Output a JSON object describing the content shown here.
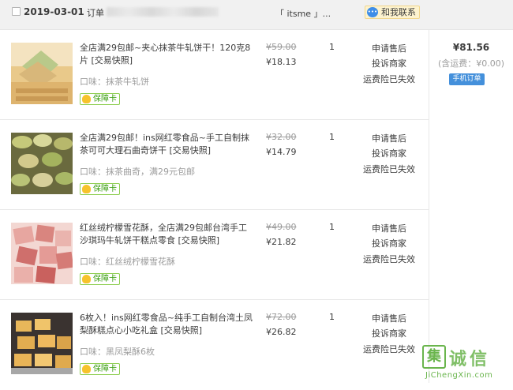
{
  "header": {
    "date": "2019-03-01",
    "order_label": "订单",
    "shop": "「 itsme 」...",
    "contact_label": "和我联系",
    "contact_icon": "wangwang-chat-icon"
  },
  "items": [
    {
      "title": "全店满29包邮~夹心抹茶牛轧饼干！120克8片 [交易快照]",
      "flavor": "口味：抹茶牛轧饼",
      "badge": "保障卡",
      "original_price": "¥59.00",
      "price": "¥18.13",
      "qty": "1",
      "actions": [
        "申请售后",
        "投诉商家",
        "运费险已失效"
      ]
    },
    {
      "title": "全店满29包邮！ins网红零食品~手工自制抹茶可可大理石曲奇饼干 [交易快照]",
      "flavor": "口味：抹茶曲奇，满29元包邮",
      "badge": "保障卡",
      "original_price": "¥32.00",
      "price": "¥14.79",
      "qty": "1",
      "actions": [
        "申请售后",
        "投诉商家",
        "运费险已失效"
      ]
    },
    {
      "title": "红丝绒柠檬雪花酥，全店满29包邮台湾手工沙琪玛牛轧饼干糕点零食 [交易快照]",
      "flavor": "口味：红丝绒柠檬雪花酥",
      "badge": "保障卡",
      "original_price": "¥49.00",
      "price": "¥21.82",
      "qty": "1",
      "actions": [
        "申请售后",
        "投诉商家",
        "运费险已失效"
      ]
    },
    {
      "title": "6枚入！ins网红零食品~纯手工自制台湾土凤梨酥糕点心小吃礼盒 [交易快照]",
      "flavor": "口味：黑凤梨酥6枚",
      "badge": "保障卡",
      "original_price": "¥72.00",
      "price": "¥26.82",
      "qty": "1",
      "actions": [
        "申请售后",
        "投诉商家",
        "运费险已失效"
      ]
    }
  ],
  "summary": {
    "total": "¥81.56",
    "shipping": "(含运费：¥0.00)",
    "mobile_order_label": "手机订单"
  },
  "watermark": {
    "box_char": "集",
    "chars": "诚信",
    "url": "JiChengXin.com"
  },
  "colors": {
    "header_bg": "#f1f1f1",
    "badge_green": "#3a9e10",
    "mobile_blue": "#4490db",
    "watermark_green": "#6ab54d"
  }
}
